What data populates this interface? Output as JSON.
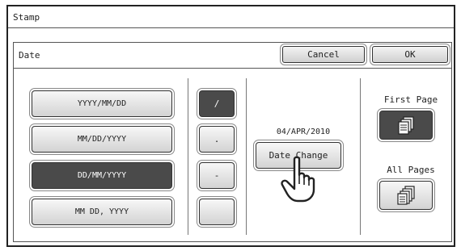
{
  "title": "Stamp",
  "panel": {
    "label": "Date",
    "cancel_label": "Cancel",
    "ok_label": "OK"
  },
  "formats": [
    {
      "label": "YYYY/MM/DD",
      "selected": false
    },
    {
      "label": "MM/DD/YYYY",
      "selected": false
    },
    {
      "label": "DD/MM/YYYY",
      "selected": true
    },
    {
      "label": "MM DD, YYYY",
      "selected": false
    }
  ],
  "separators": [
    {
      "label": "/",
      "selected": true
    },
    {
      "label": ".",
      "selected": false
    },
    {
      "label": "-",
      "selected": false
    },
    {
      "label": "",
      "selected": false
    }
  ],
  "date": {
    "value": "04/APR/2010",
    "change_label": "Date Change"
  },
  "pages": {
    "first_label": "First Page",
    "all_label": "All Pages",
    "first_icon": "single-page-stack-icon",
    "all_icon": "multi-page-stack-icon"
  },
  "colors": {
    "selected": "#4a4a4a",
    "button": "#dcdcdc"
  }
}
